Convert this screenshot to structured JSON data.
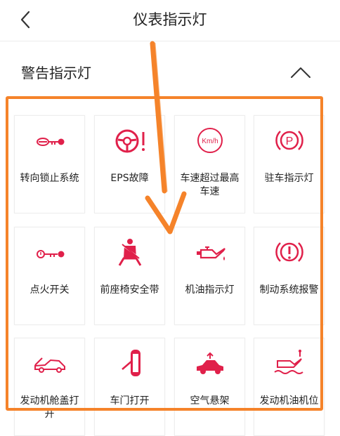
{
  "header": {
    "title": "仪表指示灯"
  },
  "section": {
    "title": "警告指示灯"
  },
  "items": [
    {
      "label": "转向锁止系统",
      "icon": "steering-lock-icon"
    },
    {
      "label": "EPS故障",
      "icon": "eps-fault-icon"
    },
    {
      "label": "车速超过最高车速",
      "icon": "speed-limit-icon"
    },
    {
      "label": "驻车指示灯",
      "icon": "parking-brake-icon"
    },
    {
      "label": "点火开关",
      "icon": "ignition-key-icon"
    },
    {
      "label": "前座椅安全带",
      "icon": "seatbelt-icon"
    },
    {
      "label": "机油指示灯",
      "icon": "oil-can-icon"
    },
    {
      "label": "制动系统报警",
      "icon": "brake-warning-icon"
    },
    {
      "label": "发动机舱盖打开",
      "icon": "hood-open-icon"
    },
    {
      "label": "车门打开",
      "icon": "door-open-icon"
    },
    {
      "label": "空气悬架",
      "icon": "air-suspension-icon"
    },
    {
      "label": "发动机油机位",
      "icon": "engine-oil-level-icon"
    }
  ],
  "icon_color": "#e0204a",
  "highlight_color": "#f5832a"
}
